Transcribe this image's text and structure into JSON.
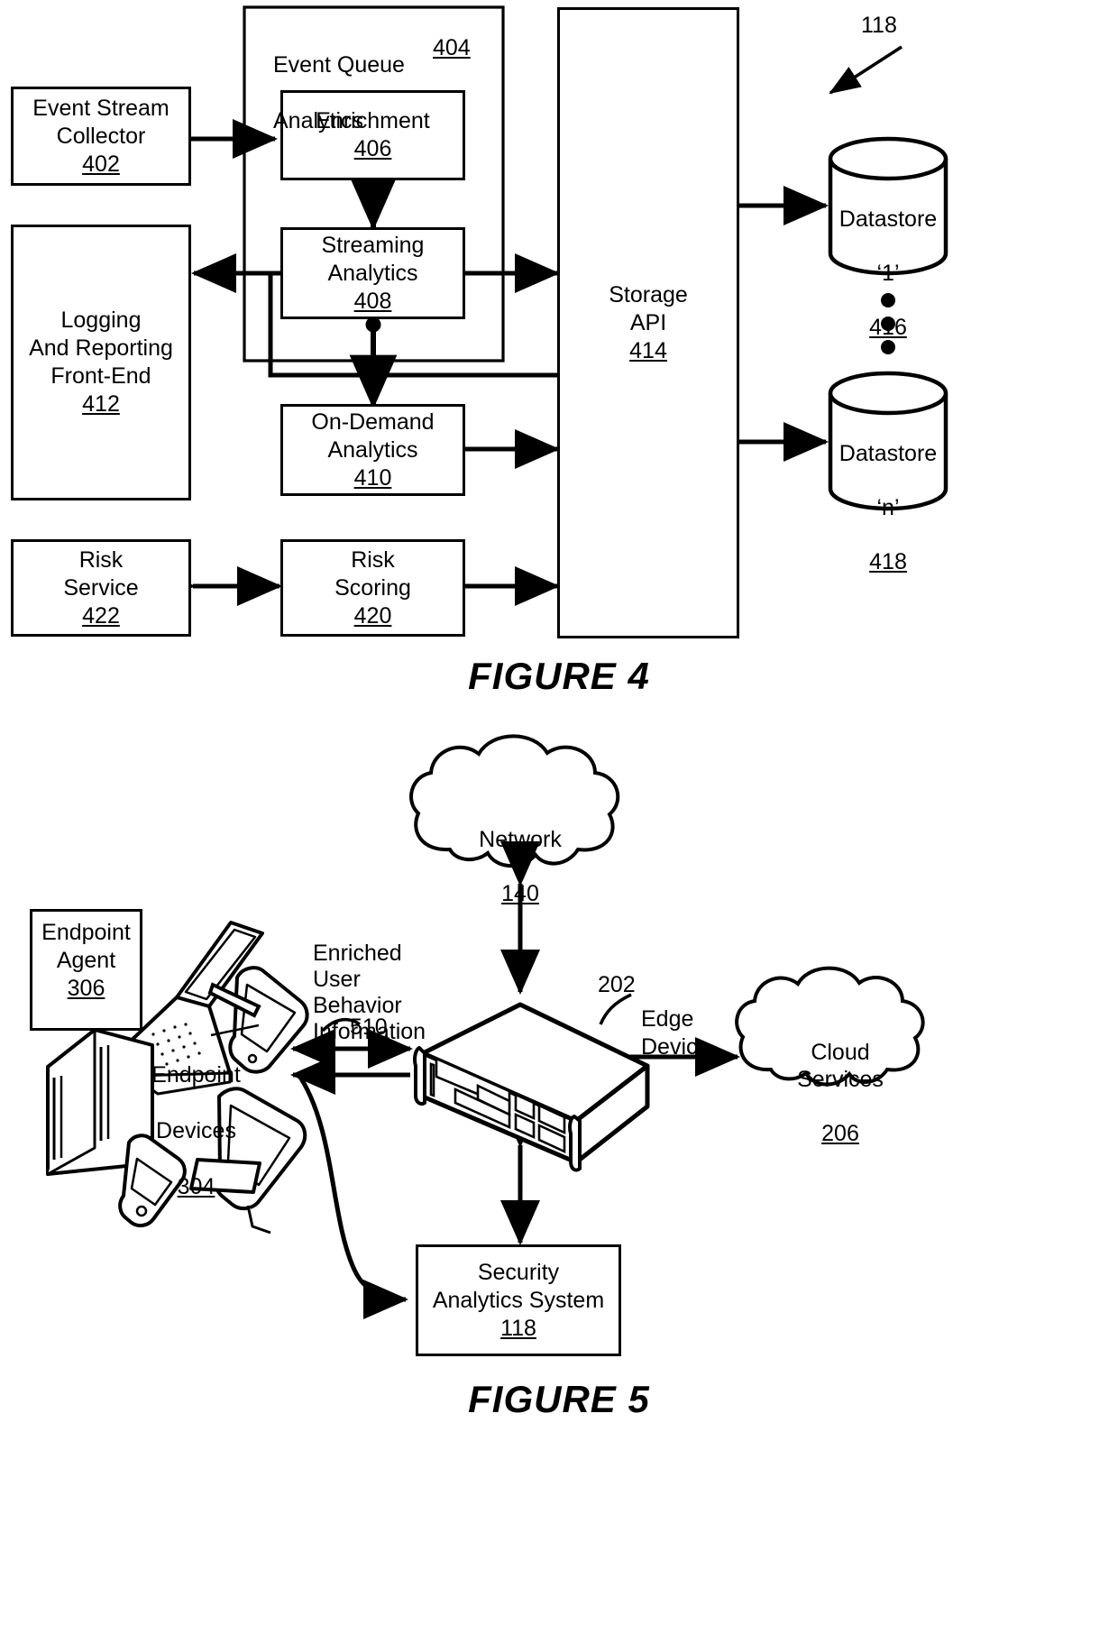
{
  "figure4": {
    "caption": "FIGURE 4",
    "container": {
      "title_line1": "Event Queue",
      "title_line2": "Analytics",
      "ref": "404"
    },
    "boxes": [
      {
        "id": "event-stream-collector",
        "line1": "Event Stream",
        "line2": "Collector",
        "ref": "402"
      },
      {
        "id": "enrichment",
        "line1": "Enrichment",
        "line2": "",
        "ref": "406"
      },
      {
        "id": "streaming-analytics",
        "line1": "Streaming",
        "line2": "Analytics",
        "ref": "408"
      },
      {
        "id": "on-demand-analytics",
        "line1": "On-Demand",
        "line2": "Analytics",
        "ref": "410"
      },
      {
        "id": "logging-reporting-front-end",
        "line1": "Logging",
        "line2": "And Reporting",
        "line3": "Front-End",
        "ref": "412"
      },
      {
        "id": "risk-service",
        "line1": "Risk",
        "line2": "Service",
        "ref": "422"
      },
      {
        "id": "risk-scoring",
        "line1": "Risk",
        "line2": "Scoring",
        "ref": "420"
      },
      {
        "id": "storage-api",
        "line1": "Storage",
        "line2": "API",
        "ref": "414"
      }
    ],
    "datastores": [
      {
        "id": "datastore-1",
        "line1": "Datastore",
        "line2": "‘1’",
        "ref": "416"
      },
      {
        "id": "datastore-n",
        "line1": "Datastore",
        "line2": "‘n’",
        "ref": "418"
      }
    ],
    "system_ref": "118"
  },
  "figure5": {
    "caption": "FIGURE 5",
    "network_cloud": {
      "label": "Network",
      "ref": "140"
    },
    "cloud_services": {
      "label": "Cloud\nServices",
      "ref": "206"
    },
    "endpoint_agent": {
      "line1": "Endpoint",
      "line2": "Agent",
      "ref": "306"
    },
    "endpoint_devices": {
      "line1": "Endpoint",
      "line2": "Devices",
      "ref": "304"
    },
    "enriched_info": {
      "text": "Enriched\nUser\nBehavior\nInformation",
      "ref": "510"
    },
    "edge_device": {
      "label": "Edge\nDevice",
      "ref": "202"
    },
    "security_analytics_system": {
      "line1": "Security",
      "line2": "Analytics System",
      "ref": "118"
    }
  }
}
